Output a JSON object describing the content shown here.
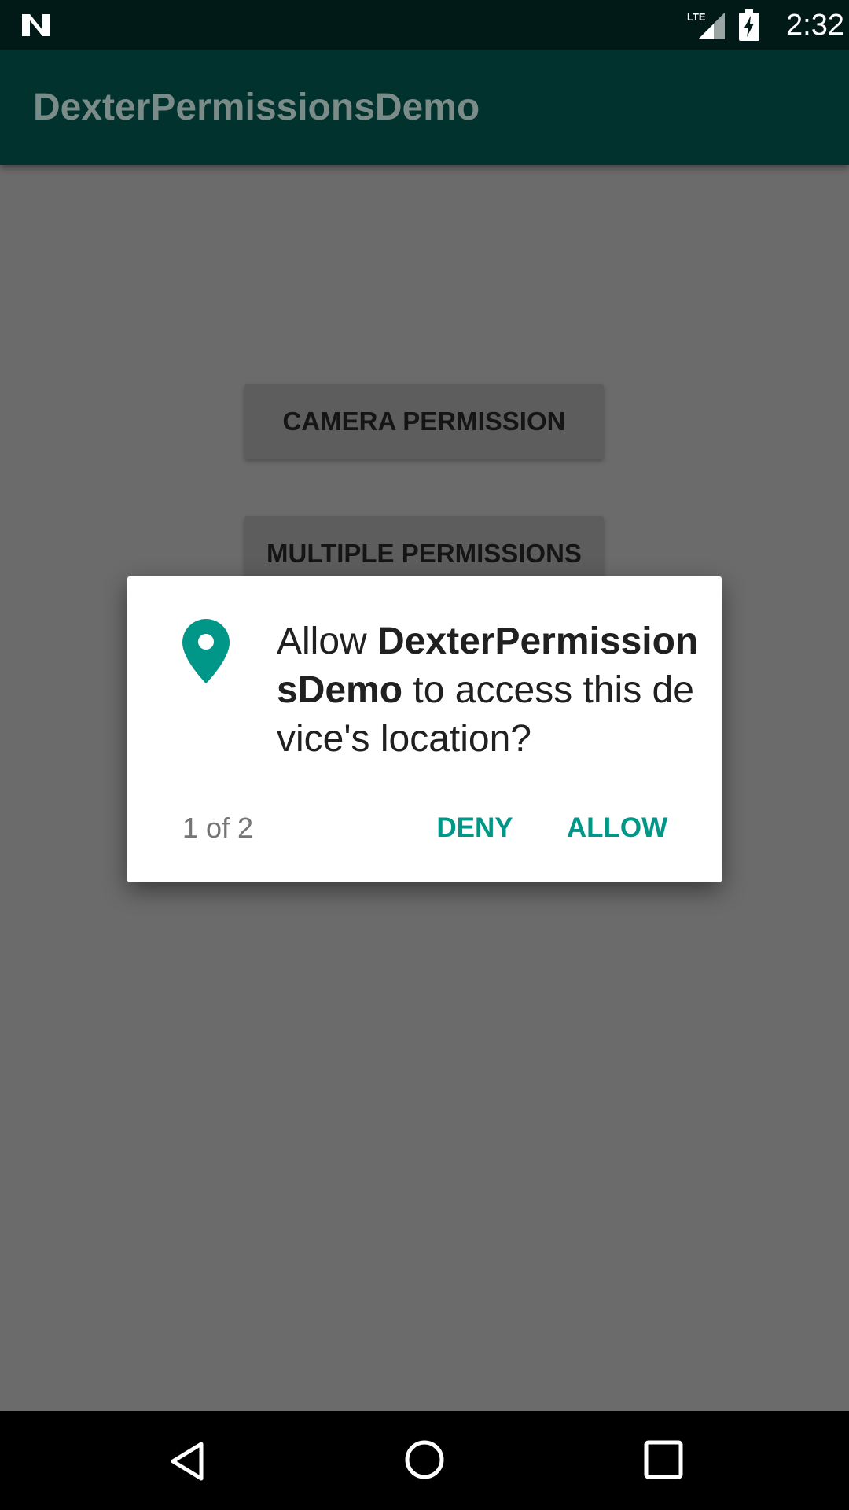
{
  "status_bar": {
    "network": "LTE",
    "time": "2:32",
    "icons": [
      "n-logo-icon",
      "lte-signal-icon",
      "battery-charging-icon"
    ]
  },
  "app_bar": {
    "title": "DexterPermissionsDemo"
  },
  "content": {
    "camera_button_label": "CAMERA PERMISSION",
    "multiple_button_label": "MULTIPLE PERMISSIONS"
  },
  "dialog": {
    "icon": "location-pin-icon",
    "message_prefix": "Allow ",
    "app_name": "DexterPermissionsDemo",
    "message_suffix": " to access this device's location?",
    "counter": "1 of 2",
    "deny_label": "DENY",
    "allow_label": "ALLOW",
    "accent_color": "#009688"
  },
  "nav_bar": {
    "icons": [
      "back-icon",
      "home-icon",
      "recents-icon"
    ]
  }
}
